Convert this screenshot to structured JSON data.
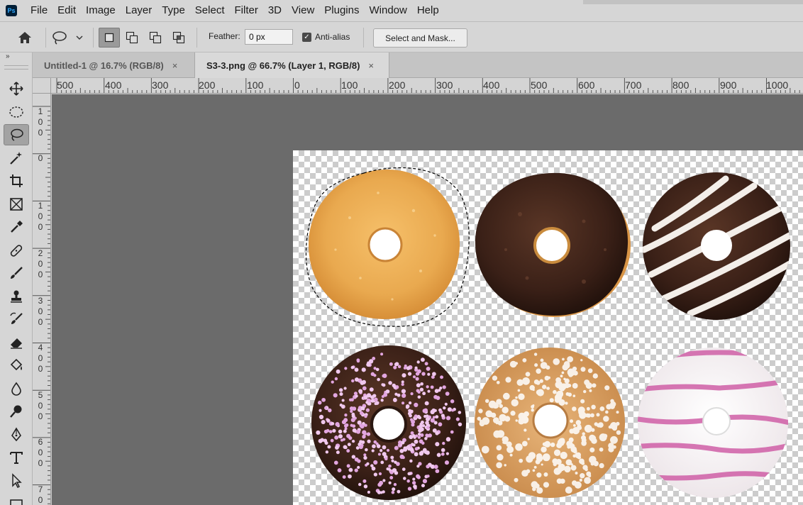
{
  "app": {
    "logo": "Ps"
  },
  "menu": [
    "File",
    "Edit",
    "Image",
    "Layer",
    "Type",
    "Select",
    "Filter",
    "3D",
    "View",
    "Plugins",
    "Window",
    "Help"
  ],
  "options": {
    "feather_label": "Feather:",
    "feather_value": "0 px",
    "antialias_label": "Anti-alias",
    "antialias_checked": true,
    "select_mask_label": "Select and Mask...",
    "selection_modes": [
      "new-selection",
      "add-to-selection",
      "subtract-from-selection",
      "intersect-with-selection"
    ]
  },
  "tabs": [
    {
      "label": "Untitled-1 @ 16.7% (RGB/8)",
      "close": "×",
      "active": false
    },
    {
      "label": "S3-3.png @ 66.7% (Layer 1, RGB/8)",
      "close": "×",
      "active": true
    }
  ],
  "ruler": {
    "horizontal": [
      "500",
      "400",
      "300",
      "200",
      "100",
      "0",
      "100",
      "200",
      "300",
      "400",
      "500",
      "600",
      "700",
      "800",
      "900",
      "1000"
    ],
    "vertical": [
      [
        "1",
        "0",
        "0"
      ],
      [
        "0"
      ],
      [
        "1",
        "0",
        "0"
      ],
      [
        "2",
        "0",
        "0"
      ],
      [
        "3",
        "0",
        "0"
      ],
      [
        "4",
        "0",
        "0"
      ],
      [
        "5",
        "0",
        "0"
      ],
      [
        "6",
        "0",
        "0"
      ],
      [
        "7",
        "0"
      ]
    ]
  },
  "tools": [
    "move-tool",
    "marquee-tool",
    "lasso-tool",
    "magic-wand-tool",
    "crop-tool",
    "frame-tool",
    "eyedropper-tool",
    "healing-brush-tool",
    "brush-tool",
    "clone-stamp-tool",
    "history-brush-tool",
    "eraser-tool",
    "paint-bucket-tool",
    "blur-tool",
    "dodge-tool",
    "pen-tool",
    "type-tool",
    "path-selection-tool",
    "rectangle-tool"
  ],
  "active_tool": "lasso-tool",
  "colors": {
    "menubar": "#d6d6d6",
    "pasteboard": "#6b6b6b",
    "checker": "#cccccc",
    "glazed": "#e9a94f",
    "chocolate": "#3a2017",
    "icing_white": "#f3eee9",
    "sprinkle_pink": "#e2a6e0",
    "pink_stripe": "#cf5fa6"
  }
}
